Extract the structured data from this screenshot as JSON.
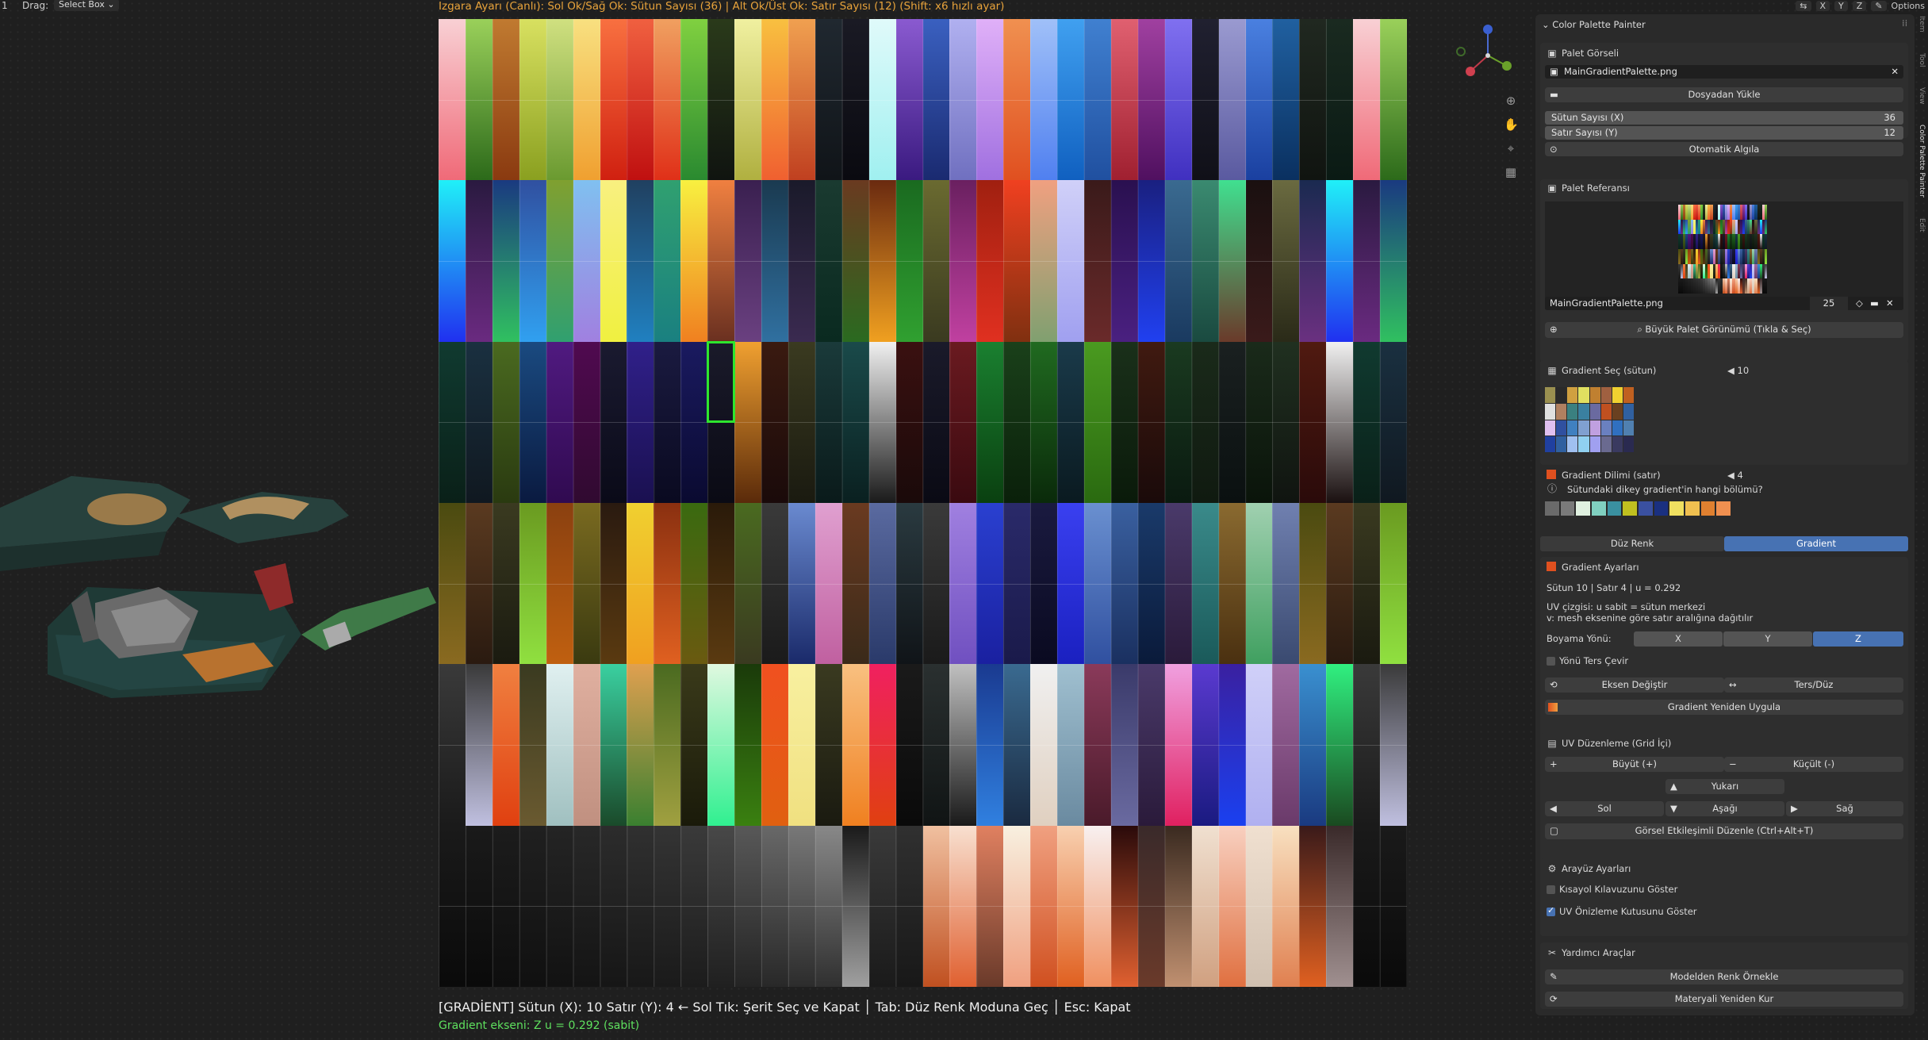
{
  "header": {
    "frame": "1",
    "drag_label": "Drag:",
    "drag_value": "Select Box",
    "hint": "Izgara Ayarı (Canlı):  Sol Ok/Sağ Ok: Sütun Sayısı (36)  |  Alt Ok/Üst Ok: Satır Sayısı (12)  (Shift: x6 hızlı ayar)",
    "options": "Options",
    "axis_buttons": [
      "X",
      "Y",
      "Z"
    ]
  },
  "status": {
    "line1": "[GRADİENT]  Sütun (X): 10  Satır (Y): 4   ← Sol Tık: Şerit Seç ve Kapat  │  Tab: Düz Renk Moduna Geç  │  Esc: Kapat",
    "line2": "Gradient ekseni: Z   u = 0.292 (sabit)"
  },
  "palette_grid": {
    "columns": 36,
    "rows": 12,
    "selected_column": 10,
    "selected_row": 4,
    "selection_color": "#2ee62e"
  },
  "panel": {
    "title": "Color Palette Painter",
    "palette_image": {
      "header": "Palet Görseli",
      "filename": "MainGradientPalette.png",
      "load_button": "Dosyadan Yükle",
      "columns_label": "Sütun Sayısı (X)",
      "columns_value": "36",
      "rows_label": "Satır Sayısı  (Y)",
      "rows_value": "12",
      "auto_detect": "Otomatik Algıla"
    },
    "palette_ref": {
      "header": "Palet Referansı",
      "filename": "MainGradientPalette.png",
      "users": "25",
      "big_view": "Büyük Palet Görünümü (Tıkla & Seç)"
    },
    "gradient_select": {
      "header": "Gradient Seç  (sütun)",
      "value": "10"
    },
    "gradient_slice": {
      "header": "Gradient Dilimi  (satır)",
      "value": "4",
      "hint": "Sütundaki dikey gradient'in hangi bölümü?"
    },
    "mode_tabs": [
      "Düz Renk",
      "Gradient"
    ],
    "gradient_settings": {
      "header": "Gradient Ayarları",
      "info": "Sütun 10 | Satır 4 | u = 0.292",
      "uv_line1": "UV çizgisi: u sabit = sütun merkezi",
      "uv_line2": "v: mesh eksenine göre satır aralığına dağıtılır",
      "paint_dir_label": "Boyama Yönü:",
      "axes": [
        "X",
        "Y",
        "Z"
      ],
      "flip_label": "Yönü Ters Çevir",
      "swap_axis": "Eksen Değiştir",
      "reverse": "Ters/Düz",
      "reapply": "Gradient Yeniden Uygula"
    },
    "uv_edit": {
      "header": "UV Düzenleme (Grid İçi)",
      "grow": "Büyüt (+)",
      "shrink": "Küçült (-)",
      "up": "Yukarı",
      "left": "Sol",
      "down": "Aşağı",
      "right": "Sağ",
      "visual": "Görsel Etkileşimli Düzenle (Ctrl+Alt+T)"
    },
    "ui_settings": {
      "header": "Arayüz Ayarları",
      "shortcut_guide": "Kısayol Kılavuzunu Göster",
      "uv_preview": "UV Önizleme Kutusunu Göster"
    },
    "helpers": {
      "header": "Yardımcı Araçlar",
      "sample": "Modelden Renk Örnekle",
      "rebuild": "Materyali Yeniden Kur"
    }
  },
  "sidebar_tabs": [
    "Item",
    "Tool",
    "View",
    "Color Palette Painter",
    "Edit"
  ],
  "colors": {
    "accent": "#4772b3",
    "hint_orange": "#e8a33b",
    "axis_green": "#5ee05e"
  }
}
